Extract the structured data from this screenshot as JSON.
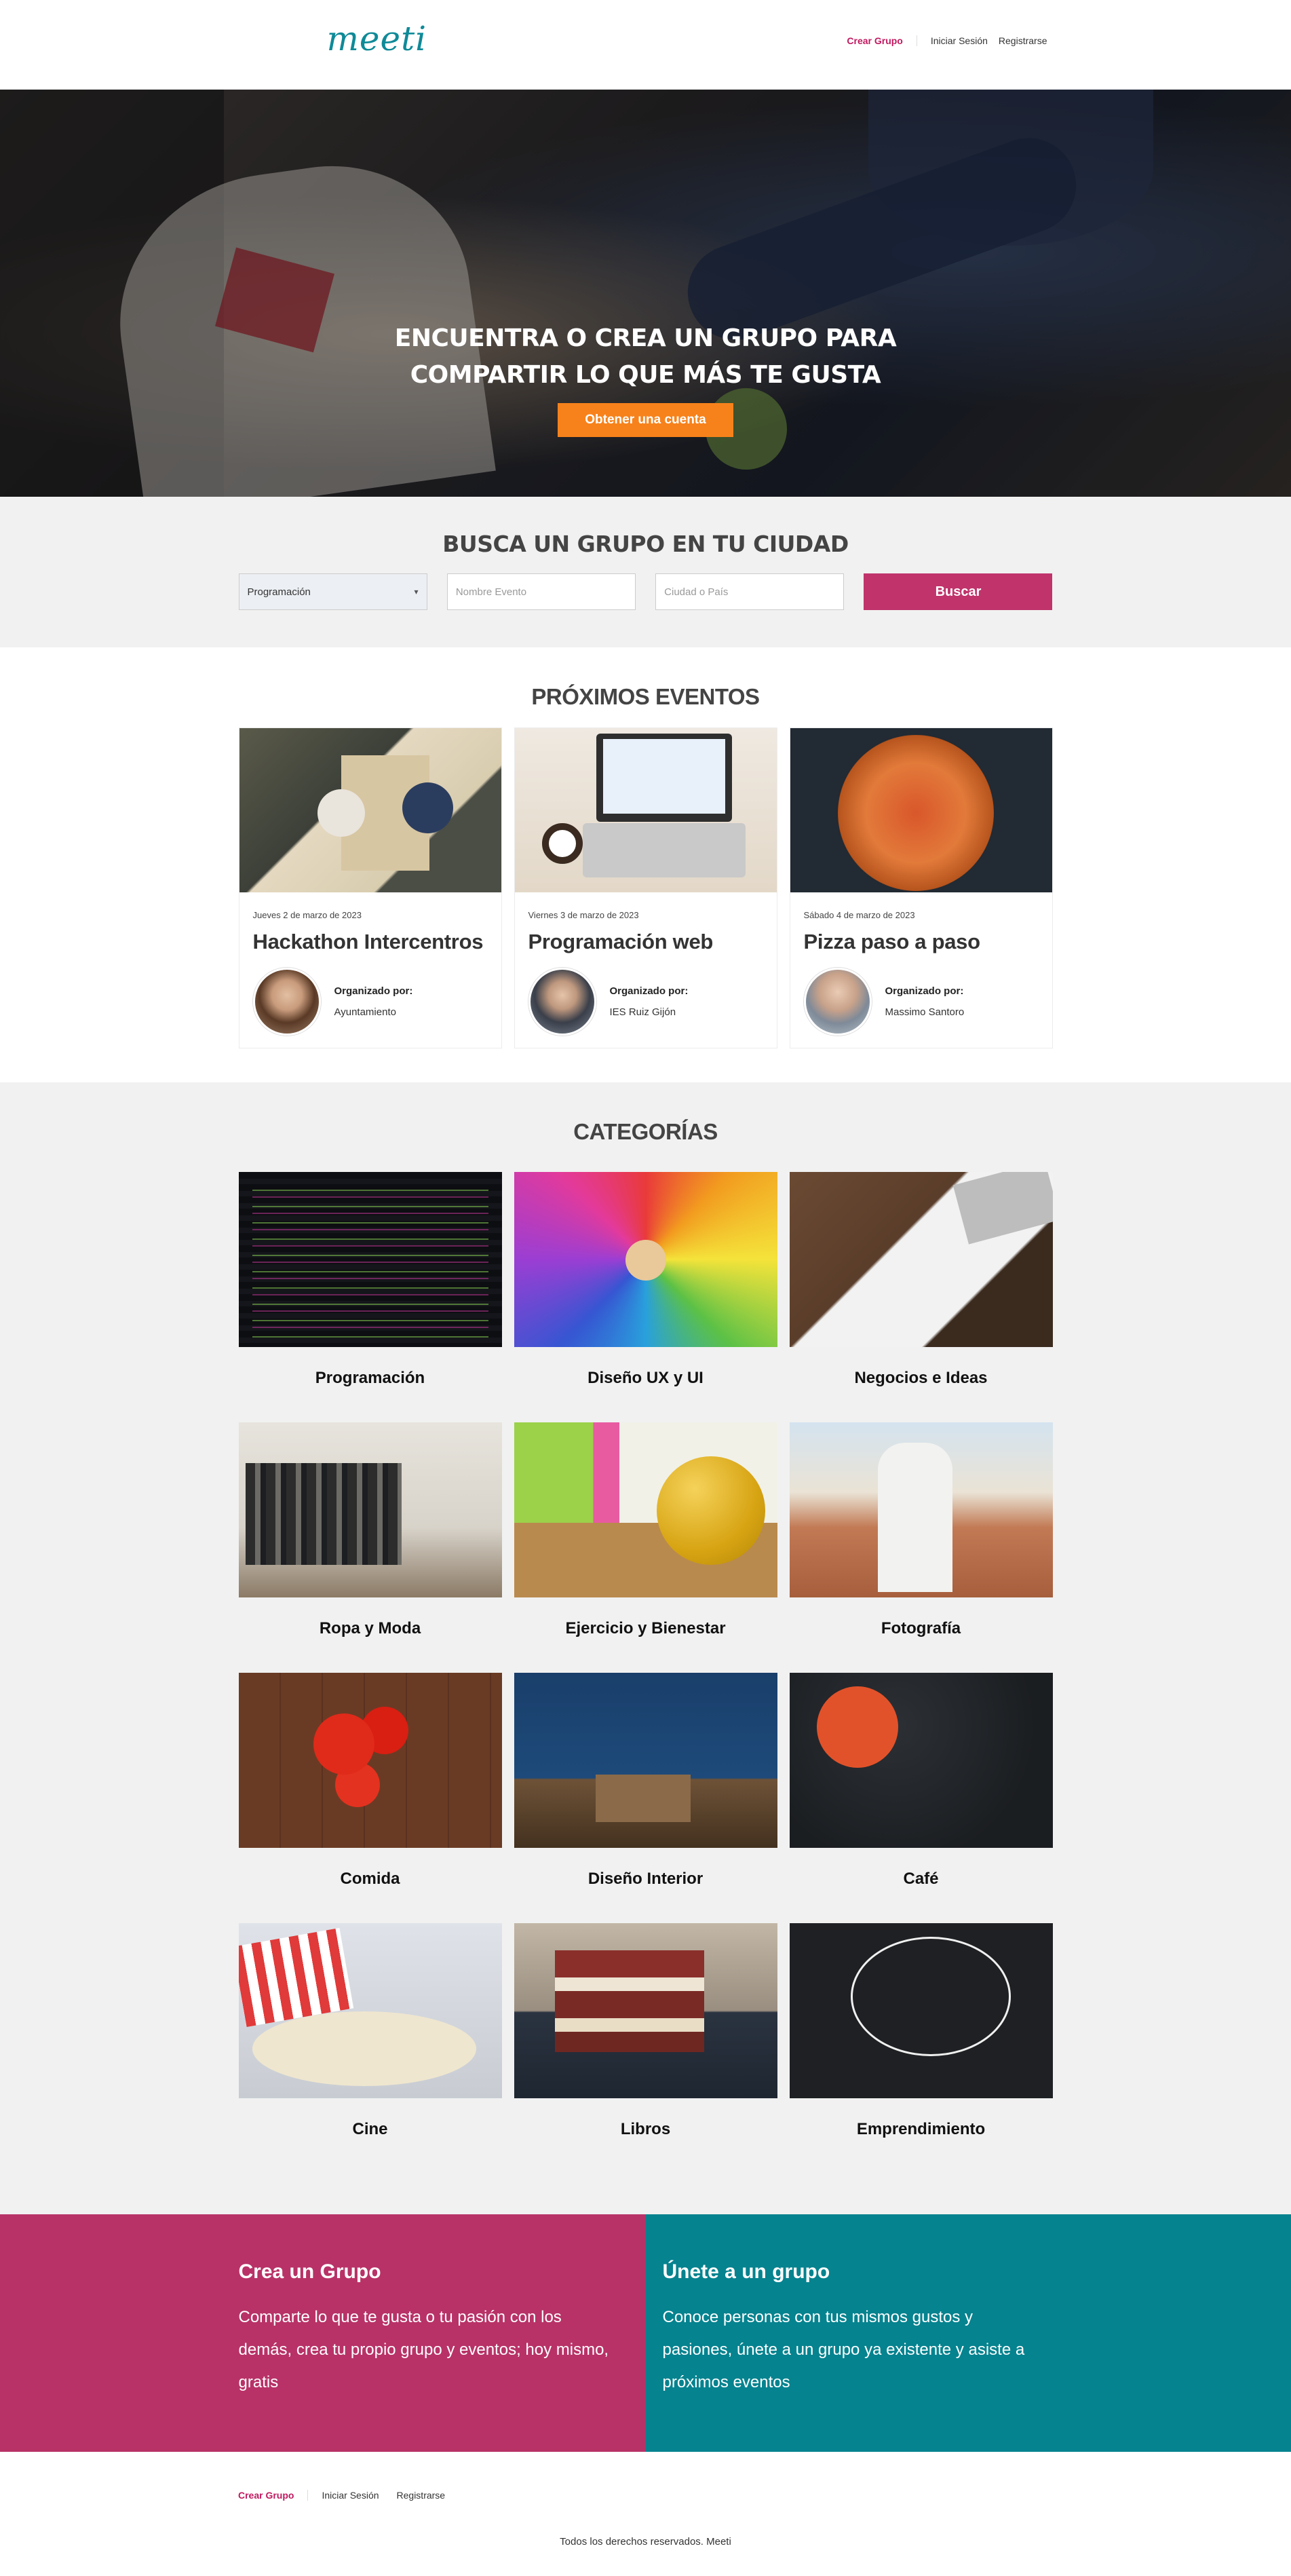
{
  "header": {
    "logo": "meeti",
    "nav": {
      "create": "Crear Grupo",
      "login": "Iniciar Sesión",
      "register": "Registrarse"
    }
  },
  "hero": {
    "title_line1": "Encuentra o crea un grupo para",
    "title_line2": "compartir lo que más te gusta",
    "cta": "Obtener una cuenta"
  },
  "search": {
    "heading": "Busca un grupo en tu ciudad",
    "category_selected": "Programación",
    "event_placeholder": "Nombre Evento",
    "city_placeholder": "Ciudad o País",
    "button": "Buscar"
  },
  "events": {
    "heading": "Próximos Eventos",
    "items": [
      {
        "date": "Jueves 2 de marzo de 2023",
        "title": "Hackathon Intercentros",
        "org_label": "Organizado por:",
        "org_name": "Ayuntamiento"
      },
      {
        "date": "Viernes 3 de marzo de 2023",
        "title": "Programación web",
        "org_label": "Organizado por:",
        "org_name": "IES Ruiz Gijón"
      },
      {
        "date": "Sábado 4 de marzo de 2023",
        "title": "Pizza paso a paso",
        "org_label": "Organizado por:",
        "org_name": "Massimo Santoro"
      }
    ]
  },
  "categories": {
    "heading": "Categorías",
    "items": [
      "Programación",
      "Diseño UX y UI",
      "Negocios e Ideas",
      "Ropa y Moda",
      "Ejercicio y Bienestar",
      "Fotografía",
      "Comida",
      "Diseño Interior",
      "Café",
      "Cine",
      "Libros",
      "Emprendimiento"
    ]
  },
  "cta": {
    "left": {
      "title": "Crea un Grupo",
      "text": "Comparte lo que te gusta o tu pasión con los demás, crea tu propio grupo y eventos; hoy mismo, gratis"
    },
    "right": {
      "title": "Únete a un grupo",
      "text": "Conoce personas con tus mismos gustos y pasiones, únete a un grupo ya existente y asiste a próximos eventos"
    }
  },
  "footer": {
    "nav": {
      "create": "Crear Grupo",
      "login": "Iniciar Sesión",
      "register": "Registrarse"
    },
    "copyright": "Todos los derechos reservados. Meeti"
  },
  "colors": {
    "brand_pink": "#c0336b",
    "brand_teal": "#05838f",
    "cta_orange": "#f7821b"
  }
}
